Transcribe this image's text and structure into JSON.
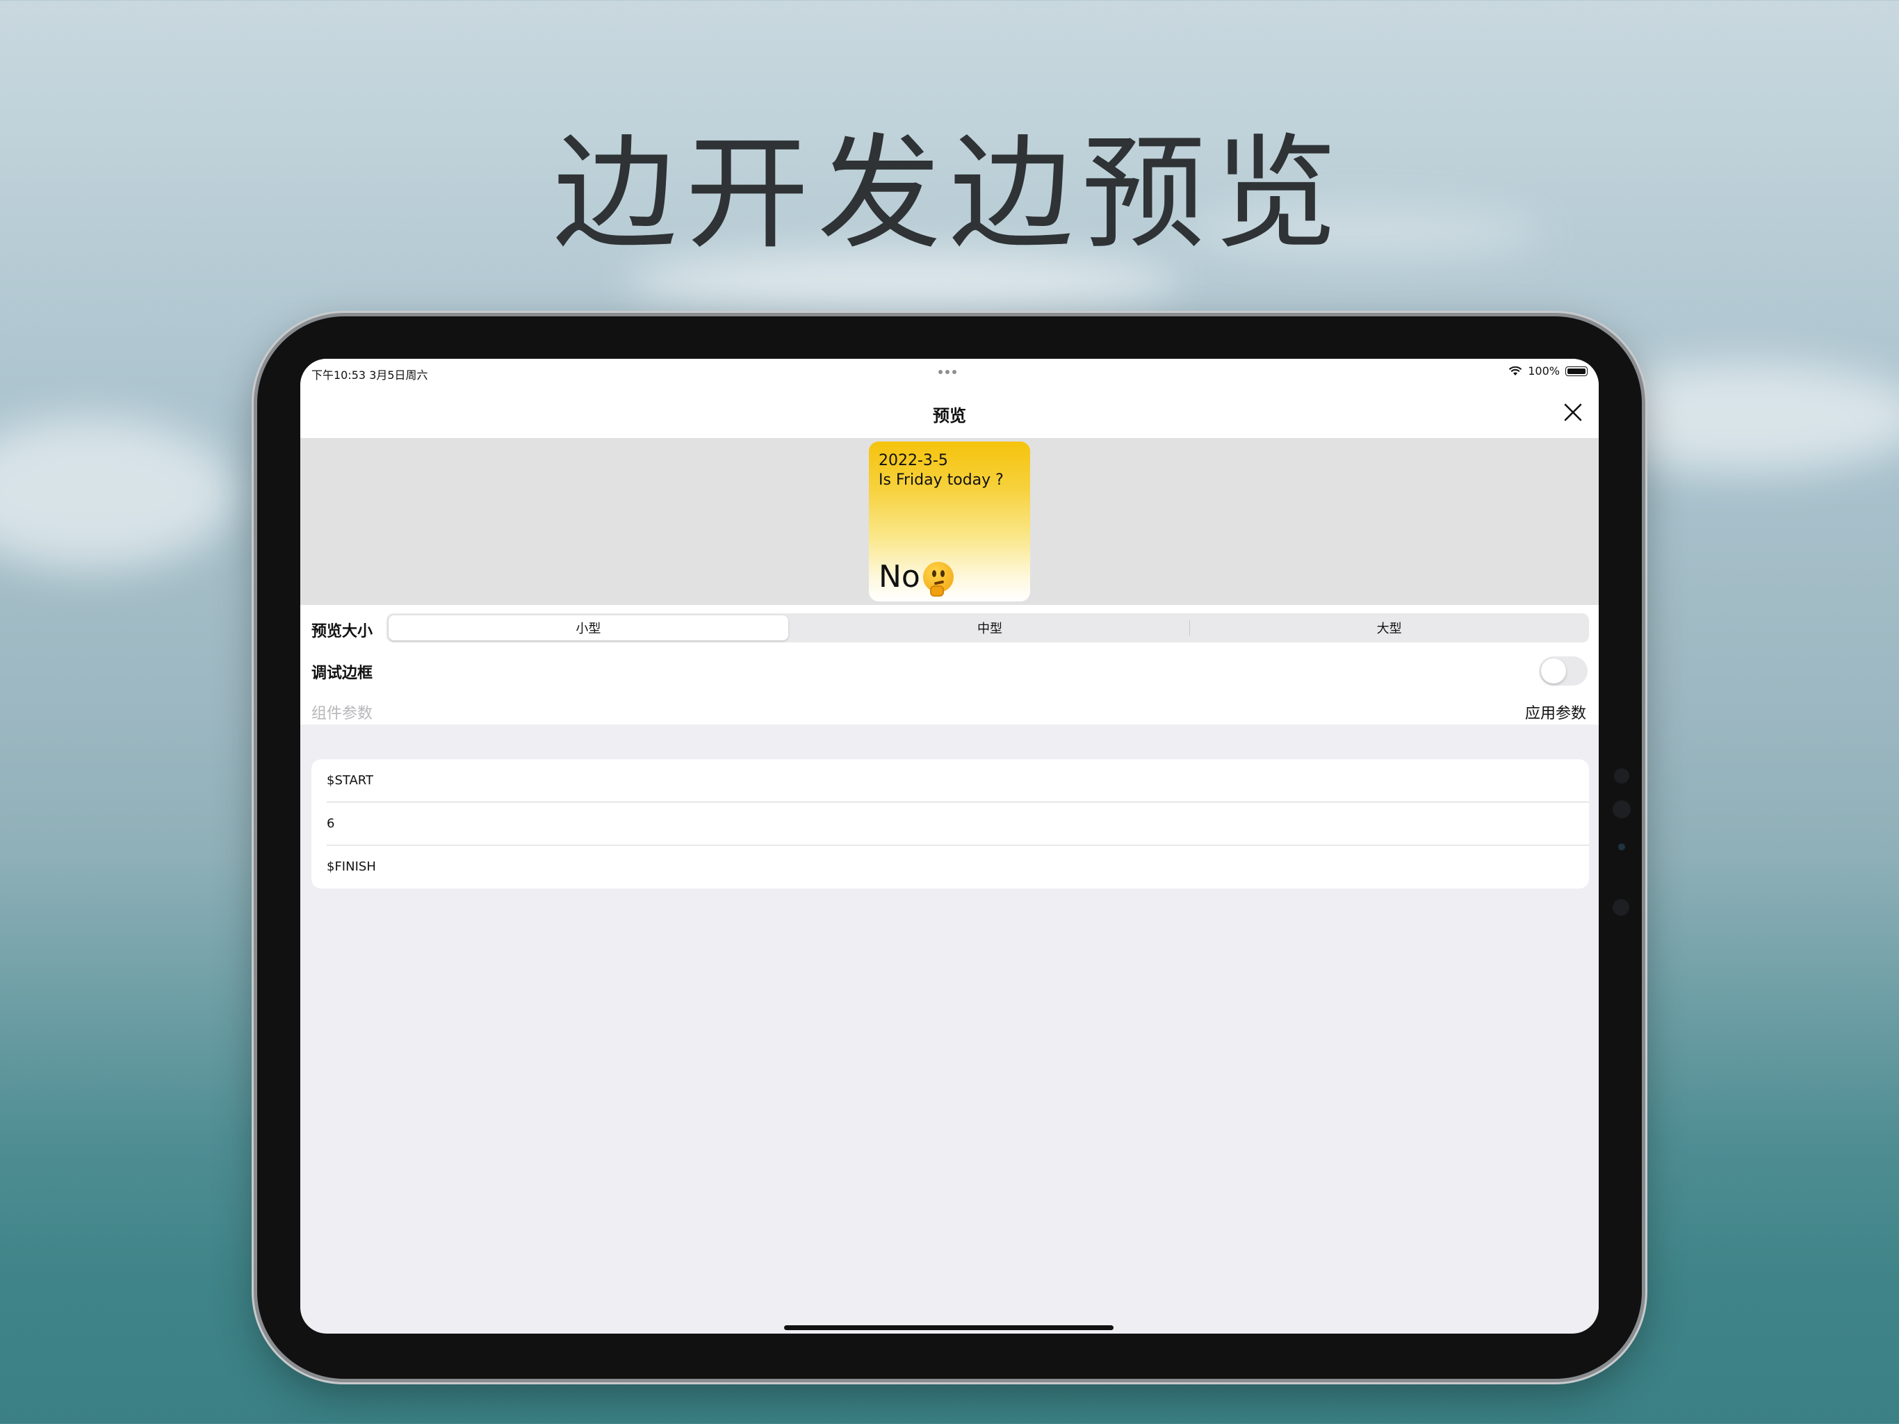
{
  "headline": "边开发边预览",
  "status_bar": {
    "time_date": "下午10:53   3月5日周六",
    "battery_percent": "100%"
  },
  "nav": {
    "title": "预览",
    "close_icon": "close-icon"
  },
  "widget": {
    "date": "2022-3-5",
    "question": "Is Friday today ?",
    "answer": "No",
    "emoji": "thinking-face"
  },
  "settings": {
    "preview_size_label": "预览大小",
    "sizes": [
      "小型",
      "中型",
      "大型"
    ],
    "selected_size": "小型",
    "debug_border_label": "调试边框",
    "debug_border_on": false,
    "params_placeholder": "组件参数",
    "apply_label": "应用参数"
  },
  "params_list": [
    "$START",
    "6",
    "$FINISH"
  ]
}
